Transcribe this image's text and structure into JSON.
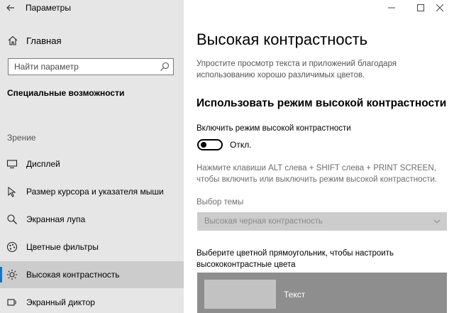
{
  "window": {
    "title": "Параметры",
    "back_icon": "back-arrow-icon",
    "controls": [
      "minimize",
      "maximize",
      "close"
    ]
  },
  "sidebar": {
    "home_label": "Главная",
    "search_placeholder": "Найти параметр",
    "section_title": "Специальные возможности",
    "group_label": "Зрение",
    "items": [
      {
        "label": "Дисплей",
        "icon": "display-icon"
      },
      {
        "label": "Размер курсора и указателя мыши",
        "icon": "cursor-icon"
      },
      {
        "label": "Экранная лупа",
        "icon": "magnifier-icon"
      },
      {
        "label": "Цветные фильтры",
        "icon": "color-filters-icon"
      },
      {
        "label": "Высокая контрастность",
        "icon": "high-contrast-icon",
        "active": true
      },
      {
        "label": "Экранный диктор",
        "icon": "narrator-icon"
      }
    ]
  },
  "main": {
    "title": "Высокая контрастность",
    "description": "Упростите просмотр текста и приложений благодаря использованию хорошо различимых цветов.",
    "subheading": "Использовать режим высокой контрастности",
    "toggle_caption": "Включить режим высокой контрастности",
    "toggle_state": "Откл.",
    "hint": "Нажмите клавиши ALT слева + SHIFT слева + PRINT SCREEN, чтобы включить или выключить режим высокой контрастности.",
    "theme_label": "Выбор темы",
    "theme_value": "Высокая черная контрастность",
    "color_caption": "Выберите цветной прямоугольник, чтобы настроить высококонтрастные цвета",
    "preview_text": "Текст"
  },
  "colors": {
    "accent": "#0078d7",
    "sidebar_bg": "#e6e6e6",
    "active_item_bg": "#cccccc",
    "preview_bg": "#8e8e8e",
    "swatch": "#c2c2c2"
  }
}
